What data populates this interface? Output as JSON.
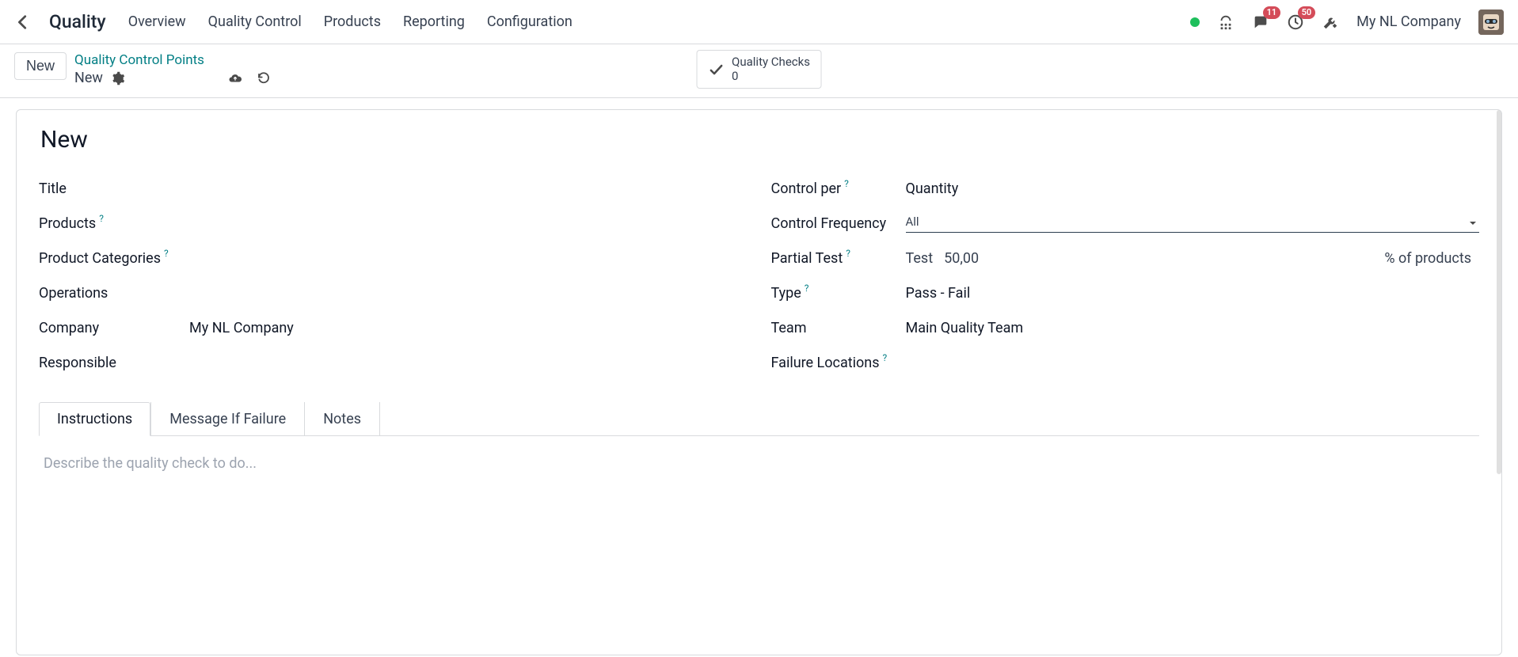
{
  "header": {
    "app_title": "Quality",
    "menu": [
      "Overview",
      "Quality Control",
      "Products",
      "Reporting",
      "Configuration"
    ],
    "messages_badge": "11",
    "activities_badge": "50",
    "company": "My NL Company"
  },
  "control": {
    "new_button": "New",
    "breadcrumb_link": "Quality Control Points",
    "breadcrumb_current": "New",
    "quality_checks_label": "Quality Checks",
    "quality_checks_count": "0"
  },
  "form": {
    "heading": "New",
    "left_labels": {
      "title": "Title",
      "products": "Products",
      "product_categories": "Product Categories",
      "operations": "Operations",
      "company": "Company",
      "responsible": "Responsible"
    },
    "left_values": {
      "company": "My NL Company"
    },
    "right_labels": {
      "control_per": "Control per",
      "control_frequency": "Control Frequency",
      "partial_test": "Partial Test",
      "type": "Type",
      "team": "Team",
      "failure_locations": "Failure Locations"
    },
    "right_values": {
      "control_per": "Quantity",
      "control_frequency": "All",
      "partial_test_prefix": "Test",
      "partial_test_value": "50,00",
      "partial_test_suffix": "% of products",
      "type": "Pass - Fail",
      "team": "Main Quality Team"
    },
    "tabs": [
      "Instructions",
      "Message If Failure",
      "Notes"
    ],
    "active_tab": 0,
    "editor_placeholder": "Describe the quality check to do..."
  }
}
